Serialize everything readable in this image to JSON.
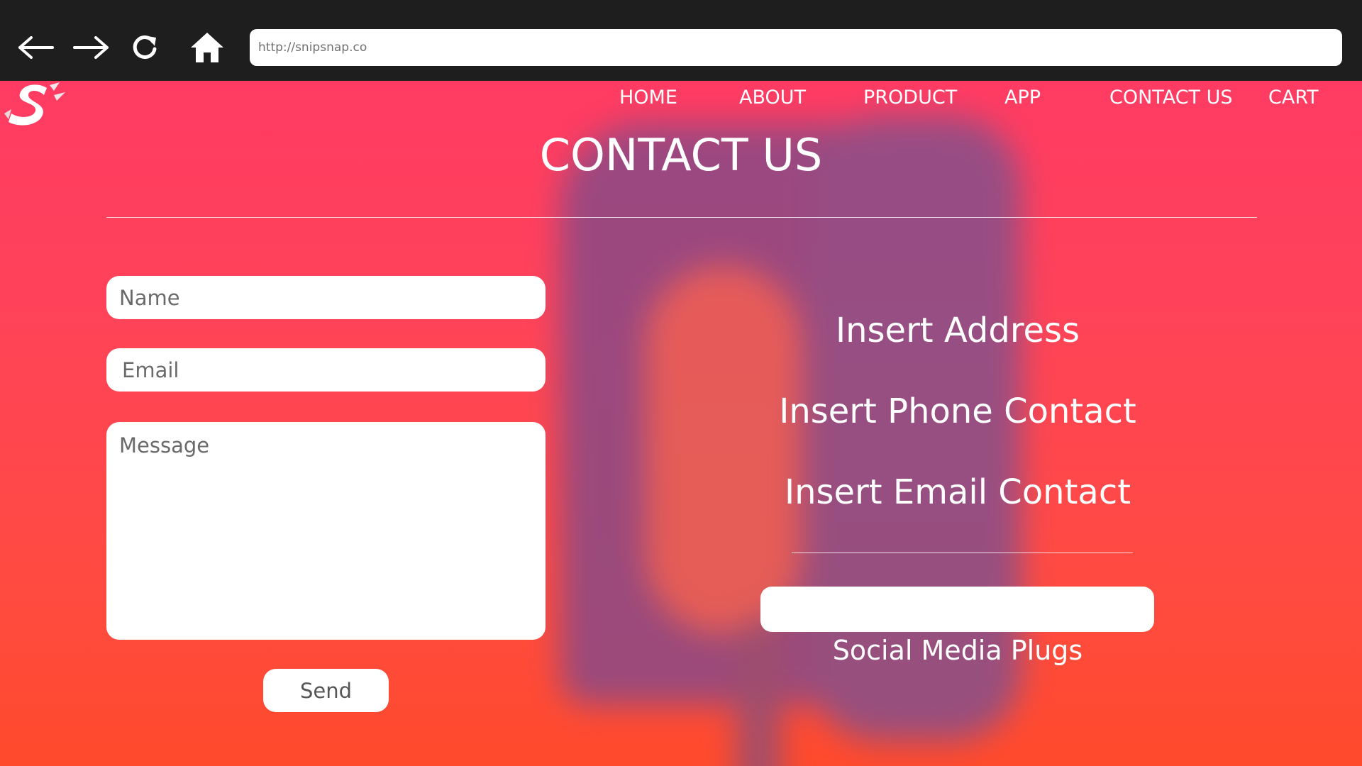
{
  "browser": {
    "url": "http://snipsnap.co",
    "icons": [
      "back-arrow-icon",
      "forward-arrow-icon",
      "reload-icon",
      "home-icon"
    ]
  },
  "nav": {
    "items": [
      {
        "label": "HOME"
      },
      {
        "label": "ABOUT"
      },
      {
        "label": "PRODUCT"
      },
      {
        "label": "APP"
      },
      {
        "label": "CONTACT US"
      },
      {
        "label": "CART"
      }
    ]
  },
  "page": {
    "title": "CONTACT US"
  },
  "form": {
    "name_placeholder": "Name",
    "email_placeholder": "Email",
    "message_placeholder": "Message",
    "send_label": "Send"
  },
  "contact": {
    "address": "Insert Address",
    "phone": "Insert Phone Contact",
    "email": "Insert Email Contact",
    "social_label": "Social Media Plugs"
  },
  "colors": {
    "browser_bar": "#1e1e1e",
    "gradient_top": "#ff3b63",
    "gradient_bottom": "#ff4a2c",
    "text": "#ffffff"
  }
}
